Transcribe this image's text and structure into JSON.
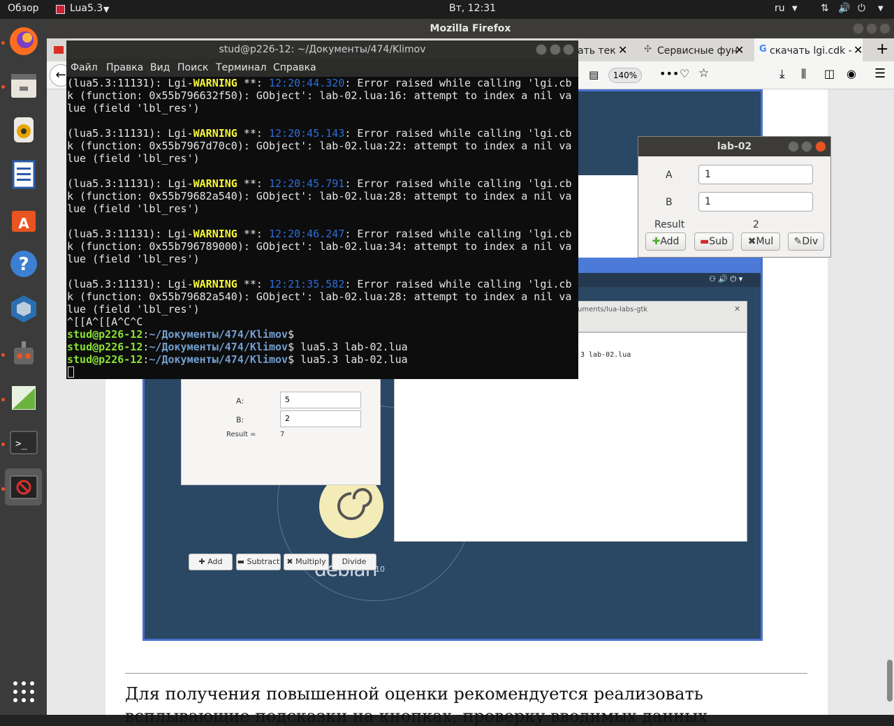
{
  "topbar": {
    "activities": "Обзор",
    "app": "Lua5.3",
    "clock": "Вт, 12:31",
    "lang": "ru"
  },
  "firefox": {
    "title": "Mozilla Firefox",
    "tabs": [
      "ать тек",
      "Сервисные фун",
      "скачать lgi.cdk -"
    ],
    "zoom": "140%"
  },
  "terminal": {
    "title": "stud@p226-12: ~/Документы/474/Klimov",
    "menu": [
      "Файл",
      "Правка",
      "Вид",
      "Поиск",
      "Терминал",
      "Справка"
    ],
    "errors": [
      {
        "ts": "12:20:44.320",
        "fn": "0x55b796632f50",
        "line": "16"
      },
      {
        "ts": "12:20:45.143",
        "fn": "0x55b7967d70c0",
        "line": "22"
      },
      {
        "ts": "12:20:45.791",
        "fn": "0x55b79682a540",
        "line": "28"
      },
      {
        "ts": "12:20:46.247",
        "fn": "0x55b796789000",
        "line": "34"
      },
      {
        "ts": "12:21:35.582",
        "fn": "0x55b79682a540",
        "line": "28"
      }
    ],
    "pid_prefix": "(lua5.3:11131): Lgi-",
    "warning": "WARNING",
    "stars": " **: ",
    "msg_a": ": Error raised while calling 'lgi.cb",
    "msg_b_pre": "k (function: ",
    "msg_b_mid": "): GObject': lab-02.lua:",
    "msg_b_post": ": attempt to index a nil va",
    "msg_c": "lue (field 'lbl_res')",
    "ctrl_line": "^[[A^[[A^C^C",
    "prompt_user": "stud@p226-12",
    "prompt_path": "~/Документы/474/Klimov",
    "commands": [
      "",
      " lua5.3 lab-02.lua",
      " lua5.3 lab-02.lua"
    ]
  },
  "lab02": {
    "title": "lab-02",
    "label_a": "A",
    "value_a": "1",
    "label_b": "B",
    "value_b": "1",
    "result_label": "Result",
    "result_value": "2",
    "buttons": [
      "Add",
      "Sub",
      "Mul",
      "Div"
    ]
  },
  "screenshot_img": {
    "label_a": "A:",
    "value_a": "5",
    "label_b": "B:",
    "value_b": "2",
    "result_label": "Result =",
    "result_value": "7",
    "buttons": [
      "Add",
      "Subtract",
      "Multiply",
      "Divide"
    ],
    "path_text": "uments/lua-labs-gtk",
    "term_cmd": "3 lab-02.lua",
    "debian": "debian",
    "debian_ver": "10"
  },
  "page": {
    "line1": "Для получения повышенной оценки рекомендуется реализовать",
    "line2": "всплывающие подсказки на кнопках, проверку вводимых данных"
  }
}
